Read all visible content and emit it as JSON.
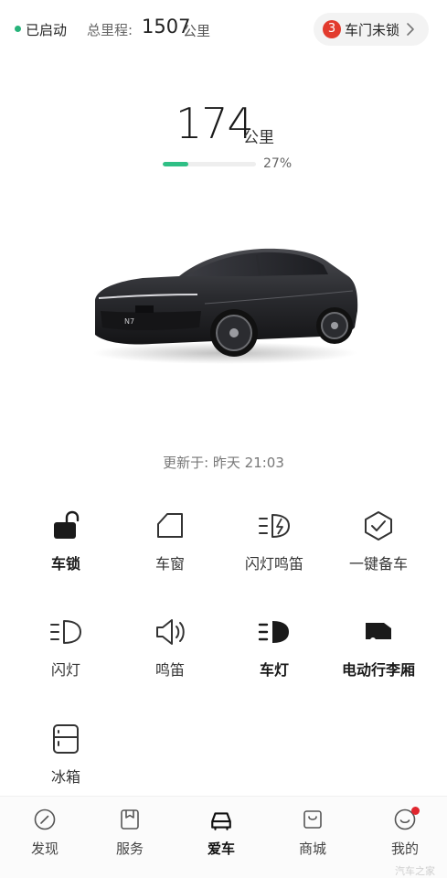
{
  "status": {
    "state": "已启动",
    "odometer_label": "总里程:",
    "odometer_value": "1507",
    "odometer_unit": "公里"
  },
  "door_alert": {
    "count": "3",
    "label": "车门未锁"
  },
  "range": {
    "value": "174",
    "unit": "公里",
    "battery_percent_text": "27%",
    "battery_percent": 27
  },
  "updated_text": "更新于: 昨天 21:03",
  "controls": [
    {
      "label": "车锁",
      "icon": "unlocked-padlock-icon"
    },
    {
      "label": "车窗",
      "icon": "window-icon"
    },
    {
      "label": "闪灯鸣笛",
      "icon": "flash-horn-icon"
    },
    {
      "label": "一键备车",
      "icon": "shield-check-icon"
    },
    {
      "label": "闪灯",
      "icon": "headlight-flash-icon"
    },
    {
      "label": "鸣笛",
      "icon": "horn-speaker-icon"
    },
    {
      "label": "车灯",
      "icon": "headlight-icon"
    },
    {
      "label": "电动行李厢",
      "icon": "power-trunk-icon"
    },
    {
      "label": "冰箱",
      "icon": "fridge-icon"
    }
  ],
  "car_badge": "N7",
  "nav": [
    {
      "label": "发现",
      "icon": "compass-icon"
    },
    {
      "label": "服务",
      "icon": "service-bookmark-icon"
    },
    {
      "label": "爱车",
      "icon": "car-icon",
      "active": true
    },
    {
      "label": "商城",
      "icon": "shop-bag-icon"
    },
    {
      "label": "我的",
      "icon": "smiley-icon",
      "notification": true
    }
  ],
  "watermark": "汽车之家",
  "colors": {
    "accent_green": "#2fbf85",
    "alert_red": "#e23b2e",
    "notif_red": "#e0262e"
  }
}
